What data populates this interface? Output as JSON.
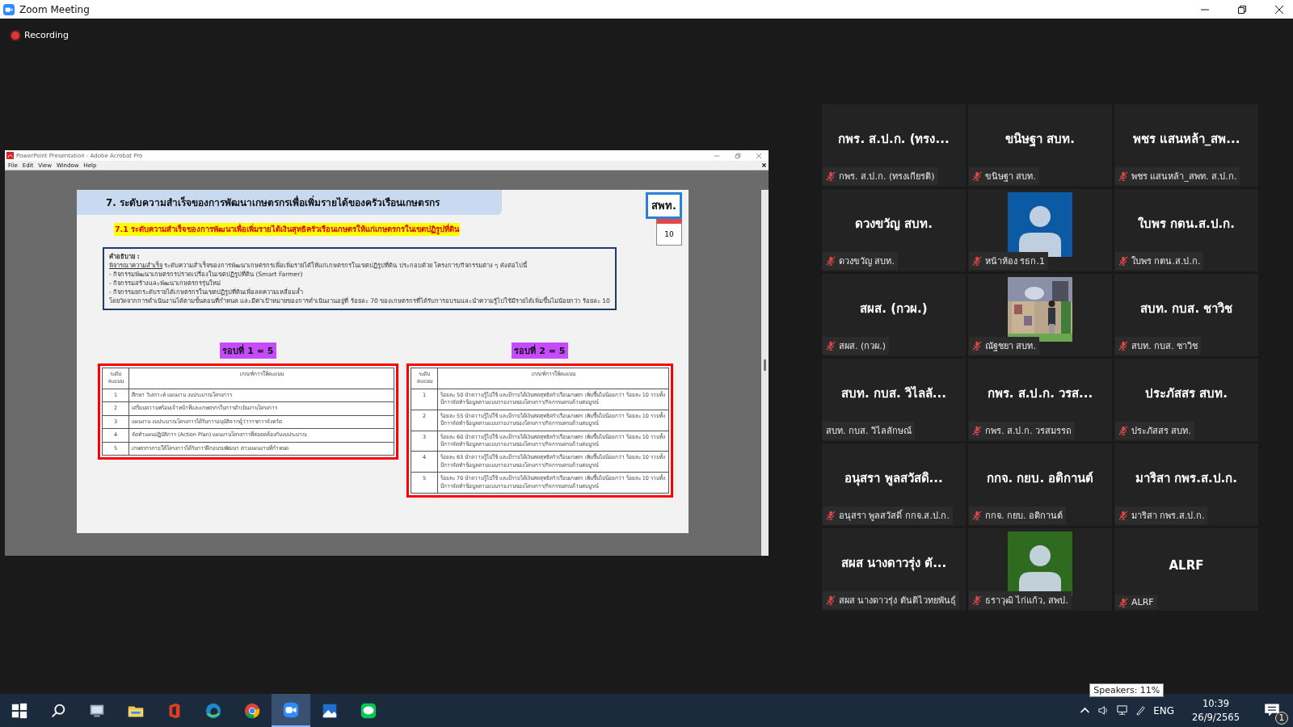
{
  "window": {
    "title": "Zoom Meeting"
  },
  "recording": {
    "label": "Recording"
  },
  "shared_window": {
    "title": "PowerPoint Presentation - Adobe Acrobat Pro",
    "menu": [
      "File",
      "Edit",
      "View",
      "Window",
      "Help"
    ],
    "slide": {
      "title": "7. ระดับความสำเร็จของการพัฒนาเกษตรกรเพื่อเพิ่มรายได้ของครัวเรือนเกษตรกร",
      "badge": "สพท.",
      "calendar_day": "10",
      "subtitle": "7.1 ระดับความสำเร็จของการพัฒนาเพื่อเพิ่มรายได้เงินสุทธิครัวเรือนเกษตรให้แก่เกษตรกรในเขตปฏิรูปที่ดิน",
      "description": {
        "heading": "คำอธิบาย :",
        "lead": "พิจารณาความสำเร็จ",
        "intro": "ระดับความสำเร็จของการพัฒนาเกษตรกรเพื่อเพิ่มรายได้ให้แก่เกษตรกรในเขตปฏิรูปที่ดิน ประกอบด้วย โครงการ/กิจกรรมต่าง ๆ ดังต่อไปนี้",
        "items": [
          "- กิจกรรมพัฒนาเกษตรกรปราดเปรื่องในเขตปฏิรูปที่ดิน (Smart Farmer)",
          "- กิจกรรมสร้างและพัฒนาเกษตรกรรุ่นใหม่",
          "- กิจกรรมยกระดับรายได้เกษตรกรในเขตปฏิรูปที่ดินเพื่อลดความเหลื่อมล้ำ"
        ],
        "closing": "โดยวัดจากการดำเนินงานได้ตามขั้นตอนที่กำหนด และมีค่าเป้าหมายของการดำเนินงานอยู่ที่ ร้อยละ 70 ของเกษตรกรที่ได้รับการอบรมและนำความรู้ไปใช้มีรายได้เพิ่มขึ้นไม่น้อยกว่า ร้อยละ 10"
      },
      "rounds": [
        {
          "label": "รอบที่ 1 = 5",
          "columns": [
            "ระดับ คะแนน",
            "เกณฑ์การให้คะแนน"
          ],
          "rows": [
            {
              "level": "1",
              "criterion": "ศึกษา วิเคราะห์ แผนงาน งบประมาณโครงการ"
            },
            {
              "level": "2",
              "criterion": "เตรียมความพร้อมเจ้าหน้าที่และเกษตรกรในการดำเนินงานโครงการ"
            },
            {
              "level": "3",
              "criterion": "แผนงาน งบประมาณโครงการได้รับการอนุมัติจากผู้ว่าราชการจังหวัด"
            },
            {
              "level": "4",
              "criterion": "จัดทำแผนปฏิบัติการ (Action Plan) แผนงานโครงการที่สอดคล้องกับงบประมาณ"
            },
            {
              "level": "5",
              "criterion": "เกษตรกรภายใต้โครงการได้รับการฝึกอบรมพัฒนา ตามแผนงานที่กำหนด"
            }
          ]
        },
        {
          "label": "รอบที่ 2 = 5",
          "columns": [
            "ระดับ คะแนน",
            "เกณฑ์การให้คะแนน"
          ],
          "rows": [
            {
              "level": "1",
              "criterion": "ร้อยละ 50 นำความรู้ไปใช้ และมีรายได้เงินสดสุทธิครัวเรือนเกษตร เพิ่มขึ้นไม่น้อยกว่า ร้อยละ 10 รวมทั้งมีการจัดทำข้อมูลตามแบบรายงานของโครงการ/กิจกรรมครบถ้วนสมบูรณ์"
            },
            {
              "level": "2",
              "criterion": "ร้อยละ 55 นำความรู้ไปใช้ และมีรายได้เงินสดสุทธิครัวเรือนเกษตร เพิ่มขึ้นไม่น้อยกว่า ร้อยละ 10 รวมทั้งมีการจัดทำข้อมูลตามแบบรายงานของโครงการ/กิจกรรมครบถ้วนสมบูรณ์"
            },
            {
              "level": "3",
              "criterion": "ร้อยละ 60 นำความรู้ไปใช้ และมีรายได้เงินสดสุทธิครัวเรือนเกษตร เพิ่มขึ้นไม่น้อยกว่า ร้อยละ 10 รวมทั้งมีการจัดทำข้อมูลตามแบบรายงานของโครงการ/กิจกรรมครบถ้วนสมบูรณ์"
            },
            {
              "level": "4",
              "criterion": "ร้อยละ 65 นำความรู้ไปใช้ และมีรายได้เงินสดสุทธิครัวเรือนเกษตร เพิ่มขึ้นไม่น้อยกว่า ร้อยละ 10 รวมทั้งมีการจัดทำข้อมูลตามแบบรายงานของโครงการ/กิจกรรมครบถ้วนสมบูรณ์"
            },
            {
              "level": "5",
              "criterion": "ร้อยละ 70 นำความรู้ไปใช้ และมีรายได้เงินสดสุทธิครัวเรือนเกษตร เพิ่มขึ้นไม่น้อยกว่า ร้อยละ 10 รวมทั้งมีการจัดทำข้อมูลตามแบบรายงานของโครงการ/กิจกรรมครบถ้วนสมบูรณ์"
            }
          ]
        }
      ]
    }
  },
  "participants": [
    {
      "kind": "name",
      "display": "กพร. ส.ป.ก. (ทรง...",
      "label": "กพร. ส.ป.ก. (ทรงเกียรติ)",
      "muted": true
    },
    {
      "kind": "name",
      "display": "ขนิษฐา สบท.",
      "label": "ขนิษฐา สบท.",
      "muted": true
    },
    {
      "kind": "name",
      "display": "พชร แสนหล้า_สพ...",
      "label": "พชร แสนหล้า_สพท. ส.ป.ก.",
      "muted": true
    },
    {
      "kind": "name",
      "display": "ดวงขวัญ สบท.",
      "label": "ดวงขวัญ สบท.",
      "muted": true
    },
    {
      "kind": "avatar",
      "color": "#0c5aa3",
      "label": "หน้าห้อง รธก.1",
      "muted": true
    },
    {
      "kind": "name",
      "display": "ใบพร  กตน.ส.ป.ก.",
      "label": "ใบพร  กตน.ส.ป.ก.",
      "muted": true
    },
    {
      "kind": "name",
      "display": "สผส. (กวผ.)",
      "label": "สผส. (กวผ.)",
      "muted": true
    },
    {
      "kind": "picture",
      "label": "ณัฐชยา สบท.",
      "muted": true
    },
    {
      "kind": "name",
      "display": "สบท. กบส. ชาวิช",
      "label": "สบท. กบส. ชาวิช",
      "muted": true
    },
    {
      "kind": "name",
      "display": "สบท. กบส. วิไลลั...",
      "label": "สบท. กบส. วิไลลักษณ์",
      "muted": false
    },
    {
      "kind": "name",
      "display": "กพร. ส.ป.ก. วรส...",
      "label": "กพร. ส.ป.ก. วรสมรรถ",
      "muted": true
    },
    {
      "kind": "name",
      "display": "ประภัสสร สบท.",
      "label": "ประภัสสร สบท.",
      "muted": true
    },
    {
      "kind": "name",
      "display": "อนุสรา พูลสวัสดิ...",
      "label": "อนุสรา พูลสวัสดิ์ กกจ.ส.ป.ก.",
      "muted": true
    },
    {
      "kind": "name",
      "display": "กกจ. กยบ. อติกานต์",
      "label": "กกจ. กยบ. อติกานต์",
      "muted": true
    },
    {
      "kind": "name",
      "display": "มาริสา กพร.ส.ป.ก.",
      "label": "มาริสา กพร.ส.ป.ก.",
      "muted": true
    },
    {
      "kind": "name",
      "display": "สผส นางดาวรุ่ง ตั...",
      "label": "สผส นางดาวรุ่ง ตันติไวทยพันธุ์",
      "muted": true
    },
    {
      "kind": "avatar",
      "color": "#2f6b1f",
      "label": "ธราวุฒิ ไก่แก้ว, สพป.",
      "muted": true
    },
    {
      "kind": "name",
      "display": "ALRF",
      "label": "ALRF",
      "muted": true
    }
  ],
  "taskbar": {
    "apps": [
      {
        "kind": "start",
        "selected": false
      },
      {
        "kind": "search",
        "selected": false
      },
      {
        "kind": "monitor",
        "selected": false
      },
      {
        "kind": "folder",
        "selected": false
      },
      {
        "kind": "office",
        "selected": false
      },
      {
        "kind": "edge",
        "selected": false
      },
      {
        "kind": "chrome",
        "selected": false
      },
      {
        "kind": "zoom",
        "selected": true
      },
      {
        "kind": "photos",
        "selected": false
      },
      {
        "kind": "line",
        "selected": false
      }
    ],
    "tooltip": "Speakers: 11%",
    "language": "ENG",
    "time": "10:39",
    "date": "26/9/2565",
    "notifications": "1"
  }
}
